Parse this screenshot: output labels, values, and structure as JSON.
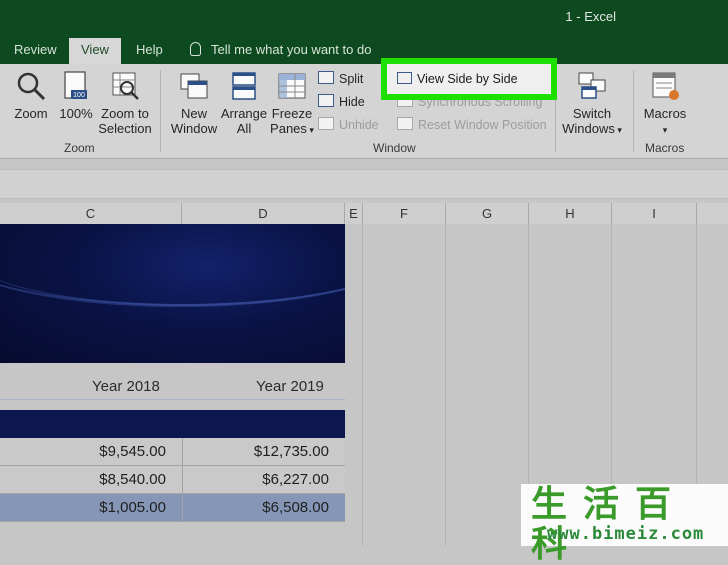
{
  "window": {
    "title": "1  -  Excel"
  },
  "tabs": [
    {
      "label": "Review",
      "active": false
    },
    {
      "label": "View",
      "active": true
    },
    {
      "label": "Help",
      "active": false
    }
  ],
  "tell_me": "Tell me what you want to do",
  "ribbon": {
    "zoom_group": {
      "label": "Zoom",
      "zoom": "Zoom",
      "hundred": "100%",
      "zoom_to_selection_l1": "Zoom to",
      "zoom_to_selection_l2": "Selection"
    },
    "window_group": {
      "label": "Window",
      "new_window_l1": "New",
      "new_window_l2": "Window",
      "arrange_all_l1": "Arrange",
      "arrange_all_l2": "All",
      "freeze_panes_l1": "Freeze",
      "freeze_panes_l2": "Panes",
      "split": "Split",
      "hide": "Hide",
      "unhide": "Unhide",
      "view_side_by_side": "View Side by Side",
      "synchronous_scrolling": "Synchronous Scrolling",
      "reset_window_position": "Reset Window Position",
      "switch_windows_l1": "Switch",
      "switch_windows_l2": "Windows"
    },
    "macros_group": {
      "label": "Macros",
      "macros": "Macros"
    },
    "highlight_color": "#1de000"
  },
  "columns": [
    "C",
    "D",
    "E",
    "F",
    "G",
    "H",
    "I"
  ],
  "sheet": {
    "headers": [
      "Year 2018",
      "Year 2019"
    ],
    "rows": [
      {
        "c": "$9,545.00",
        "d": "$12,735.00",
        "selected": false
      },
      {
        "c": "$8,540.00",
        "d": "$6,227.00",
        "selected": false
      },
      {
        "c": "$1,005.00",
        "d": "$6,508.00",
        "selected": true
      }
    ]
  },
  "watermark": {
    "chinese": "生活百科",
    "url": "www.bimeiz.com"
  },
  "colors": {
    "excel_green": "#0e4a1f",
    "navy": "#0c1750",
    "selected_row": "#8596b6"
  }
}
